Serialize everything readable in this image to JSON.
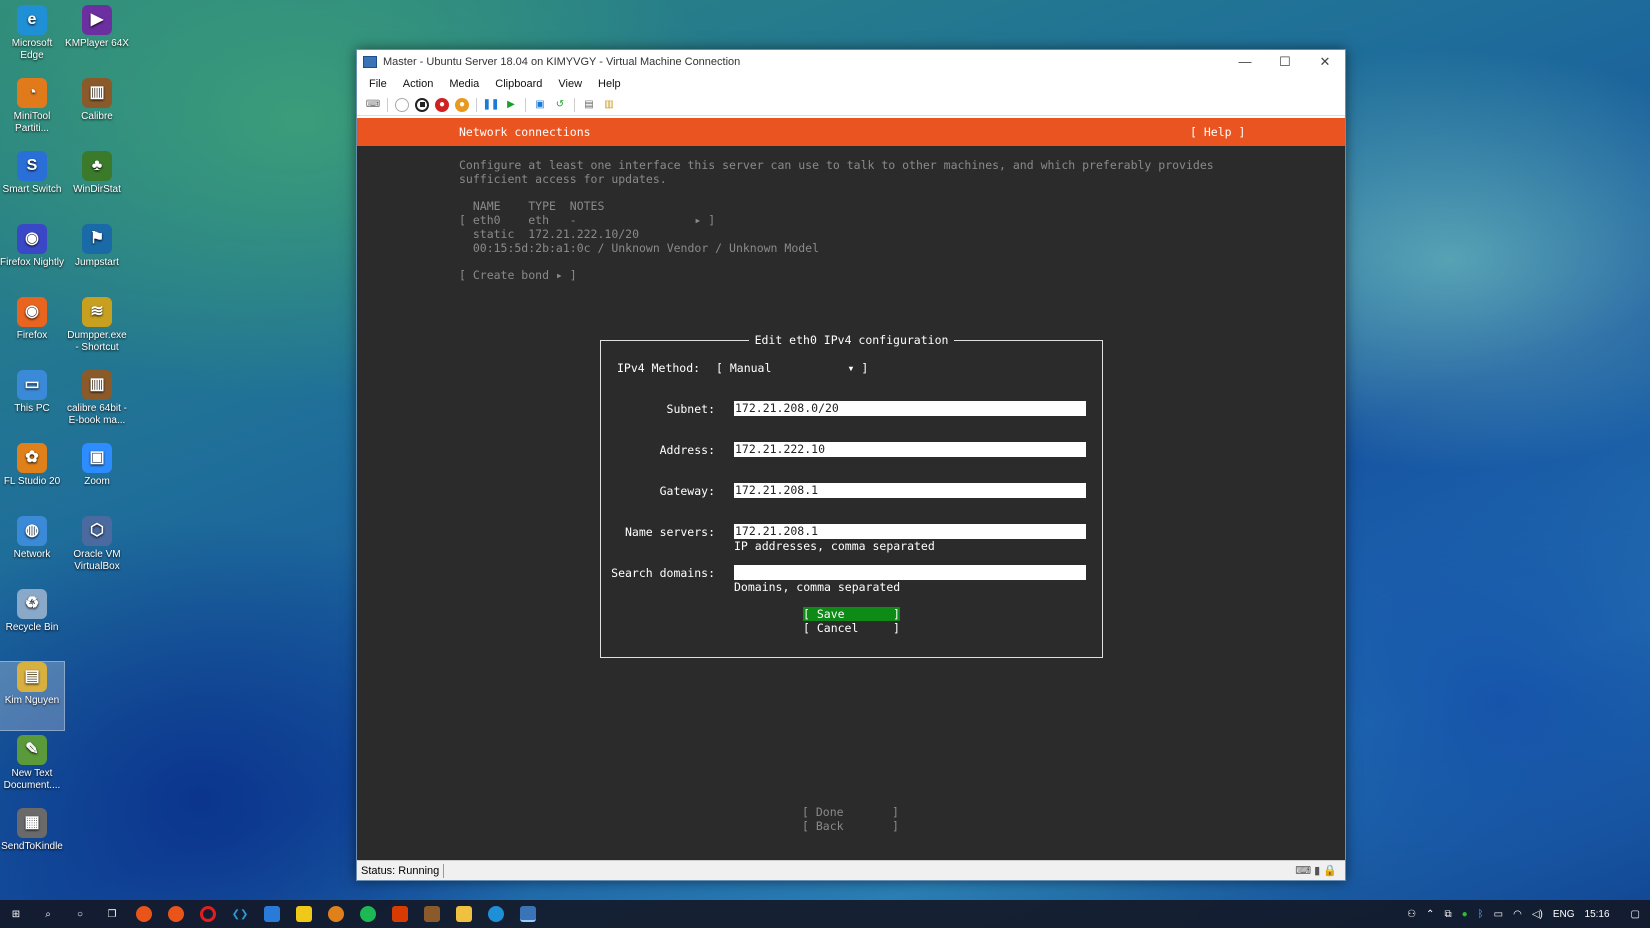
{
  "desktop": {
    "icons": [
      {
        "label": "Microsoft Edge",
        "color": "#1f8fd6",
        "glyph": "e"
      },
      {
        "label": "KMPlayer 64X",
        "color": "#6b2fa0",
        "glyph": "▶"
      },
      {
        "label": "MiniTool Partiti...",
        "color": "#e07a1a",
        "glyph": "◔"
      },
      {
        "label": "Calibre",
        "color": "#8a5a2b",
        "glyph": "▥"
      },
      {
        "label": "Smart Switch",
        "color": "#2a6fd8",
        "glyph": "S"
      },
      {
        "label": "WinDirStat",
        "color": "#3a7a2a",
        "glyph": "♣"
      },
      {
        "label": "Firefox Nightly",
        "color": "#3a48c8",
        "glyph": "◉"
      },
      {
        "label": "Jumpstart",
        "color": "#1a6aa8",
        "glyph": "⚑"
      },
      {
        "label": "Firefox",
        "color": "#e8641f",
        "glyph": "◉"
      },
      {
        "label": "Dumpper.exe - Shortcut",
        "color": "#c8a020",
        "glyph": "≋"
      },
      {
        "label": "This PC",
        "color": "#3a8ad8",
        "glyph": "▭"
      },
      {
        "label": "calibre 64bit - E-book ma...",
        "color": "#8a5a2b",
        "glyph": "▥"
      },
      {
        "label": "FL Studio 20",
        "color": "#e0801a",
        "glyph": "✿"
      },
      {
        "label": "Zoom",
        "color": "#2d8cff",
        "glyph": "▣"
      },
      {
        "label": "Network",
        "color": "#3a8ad8",
        "glyph": "◍"
      },
      {
        "label": "Oracle VM VirtualBox",
        "color": "#4a6aa0",
        "glyph": "⬡"
      },
      {
        "label": "Recycle Bin",
        "color": "#8aa8c8",
        "glyph": "♻"
      },
      {
        "label": "Kim Nguyen",
        "color": "#d8b040",
        "glyph": "▤"
      },
      {
        "label": "New Text Document....",
        "color": "#5a9a3a",
        "glyph": "✎"
      },
      {
        "label": "SendToKindle",
        "color": "#6a6a6a",
        "glyph": "▦"
      }
    ]
  },
  "window": {
    "title": "Master - Ubuntu Server 18.04 on KIMYVGY - Virtual Machine Connection",
    "menu": [
      "File",
      "Action",
      "Media",
      "Clipboard",
      "View",
      "Help"
    ],
    "status": "Status: Running"
  },
  "installer": {
    "header": "Network connections",
    "help": "[ Help ]",
    "intro_line1": "Configure at least one interface this server can use to talk to other machines, and which preferably provides",
    "intro_line2": "sufficient access for updates.",
    "table_header": "  NAME    TYPE  NOTES",
    "iface_line": "[ eth0    eth   -                 ▸ ]",
    "iface_static": "  static  172.21.222.10/20",
    "iface_hw": "  00:15:5d:2b:a1:0c / Unknown Vendor / Unknown Model",
    "create_bond": "[ Create bond ▸ ]",
    "done": "[ Done       ]",
    "back": "[ Back       ]"
  },
  "dialog": {
    "title": "Edit eth0 IPv4 configuration",
    "method_label": "IPv4 Method:",
    "method_value": "[ Manual           ▾ ]",
    "subnet_label": "Subnet:",
    "subnet_value": "172.21.208.0/20",
    "address_label": "Address:",
    "address_value": "172.21.222.10",
    "gateway_label": "Gateway:",
    "gateway_value": "172.21.208.1",
    "nameservers_label": "Name servers:",
    "nameservers_value": "172.21.208.1",
    "nameservers_hint": "IP addresses, comma separated",
    "search_label": "Search domains:",
    "search_value": "",
    "search_hint": "Domains, comma separated",
    "save": "[ Save       ]",
    "cancel": "[ Cancel     ]"
  },
  "taskbar": {
    "lang": "ENG",
    "time": "15:16"
  }
}
